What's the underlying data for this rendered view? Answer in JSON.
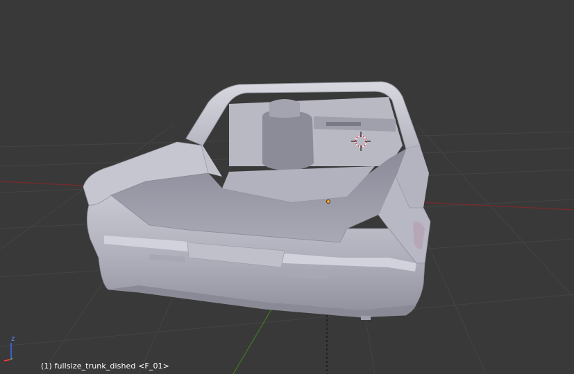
{
  "viewport": {
    "background": "#393939",
    "grid_color": "#4a4a4a",
    "x_axis_color": "#8f2d2d",
    "y_axis_color": "#5a8f2d",
    "z_axis_color": "#2a2a2a",
    "model_color": "#b7b7c2"
  },
  "gizmo": {
    "z_label": "z",
    "z_color": "#3b6cff",
    "x_color": "#ff3b3b",
    "y_color": "#3bbf3b"
  },
  "status": {
    "object_info": "(1) fullsize_trunk_dished <F_01>"
  },
  "icons": {
    "cursor_3d": "3d-cursor-icon",
    "origin": "object-origin-icon"
  }
}
